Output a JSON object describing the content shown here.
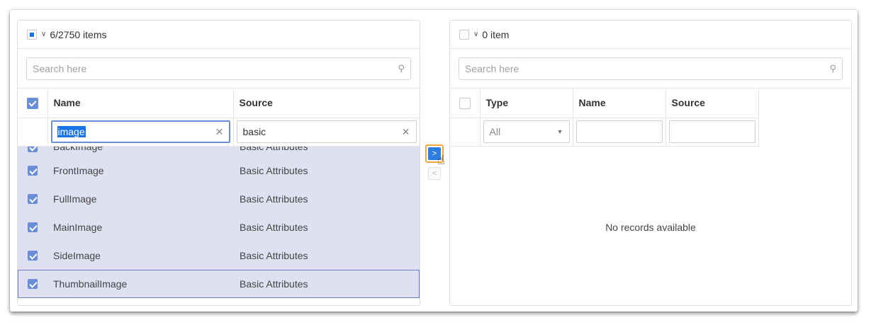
{
  "left": {
    "header_count": "6/2750 items",
    "search_placeholder": "Search here",
    "columns": {
      "name": "Name",
      "source": "Source"
    },
    "filters": {
      "name": "image",
      "source": "basic"
    },
    "rows": [
      {
        "name": "BackImage",
        "source": "Basic Attributes"
      },
      {
        "name": "FrontImage",
        "source": "Basic Attributes"
      },
      {
        "name": "FullImage",
        "source": "Basic Attributes"
      },
      {
        "name": "MainImage",
        "source": "Basic Attributes"
      },
      {
        "name": "SideImage",
        "source": "Basic Attributes"
      },
      {
        "name": "ThumbnailImage",
        "source": "Basic Attributes"
      }
    ]
  },
  "right": {
    "header_count": "0 item",
    "search_placeholder": "Search here",
    "columns": {
      "type": "Type",
      "name": "Name",
      "source": "Source"
    },
    "filters": {
      "type": "All"
    },
    "empty_text": "No records available"
  },
  "transfer": {
    "to_right": ">",
    "to_left": "<"
  },
  "icons": {
    "chevron": "chevron-down-icon",
    "search": "search-icon",
    "clear": "close-icon",
    "cursor": "hand-pointer-icon"
  },
  "colors": {
    "selected_row_bg": "#dfe1f2",
    "checkbox_checked": "#6a8fd8",
    "primary": "#2e7de0",
    "focus_outline": "#f2a93b"
  }
}
